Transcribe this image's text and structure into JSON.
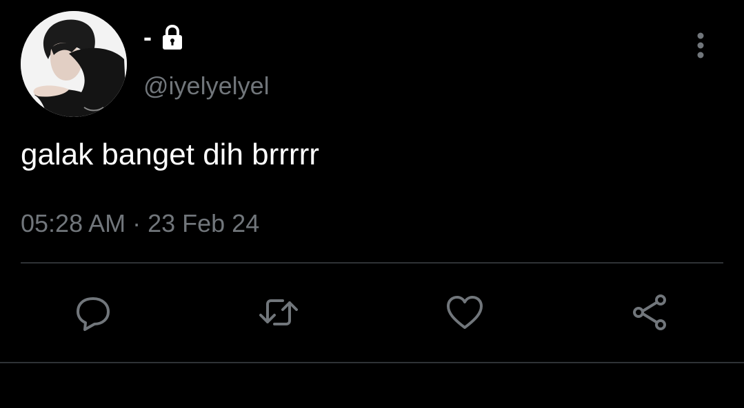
{
  "tweet": {
    "display_name": "-",
    "protected_icon": "lock-icon",
    "handle": "@iyelyelyel",
    "text": "galak banget dih brrrrr",
    "timestamp": "05:28 AM · 23 Feb 24",
    "more_icon": "more-vertical-icon"
  },
  "actions": [
    {
      "name": "reply",
      "icon": "reply-icon"
    },
    {
      "name": "retweet",
      "icon": "retweet-icon"
    },
    {
      "name": "like",
      "icon": "heart-icon"
    },
    {
      "name": "share",
      "icon": "share-icon"
    }
  ],
  "colors": {
    "background": "#000000",
    "primary_text": "#ffffff",
    "secondary_text": "#71767b",
    "divider": "#2f3336"
  }
}
